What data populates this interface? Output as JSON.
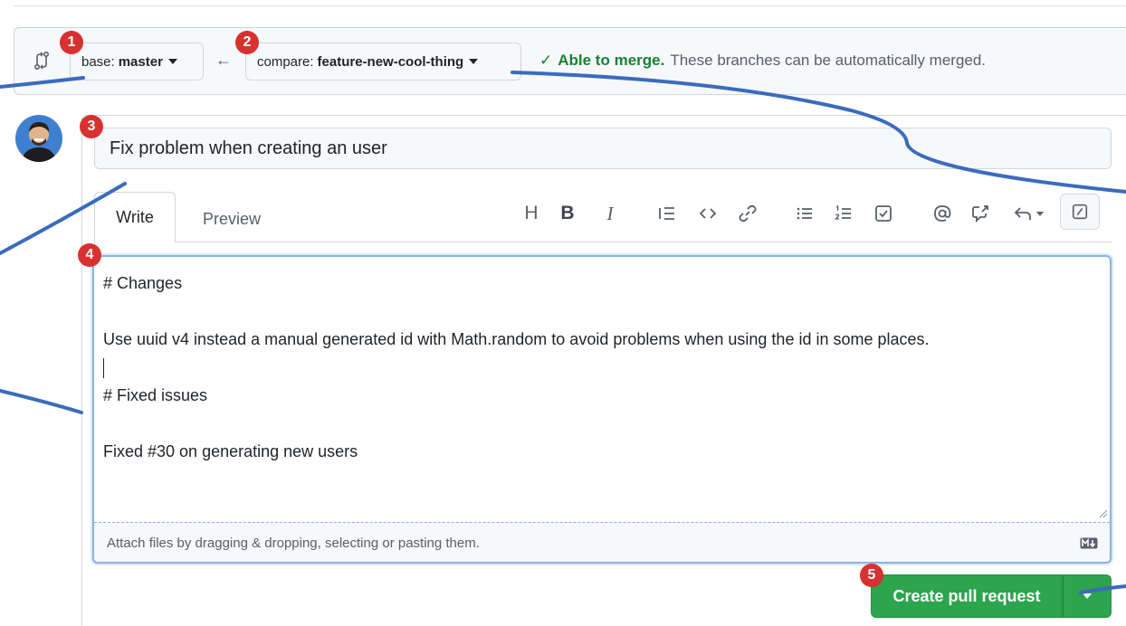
{
  "compare": {
    "base_label": "base:",
    "base_value": "master",
    "compare_label": "compare:",
    "compare_value": "feature-new-cool-thing",
    "arrow": "←",
    "status_check": "✓",
    "status_ok": "Able to merge.",
    "status_text": "These branches can be automatically merged."
  },
  "form": {
    "title_value": "Fix problem when creating an user",
    "tabs": [
      "Write",
      "Preview"
    ],
    "toolbar": [
      {
        "name": "heading",
        "glyph": "H"
      },
      {
        "name": "bold",
        "glyph": "B"
      },
      {
        "name": "italic",
        "glyph": "I"
      }
    ],
    "body_lines": [
      "# Changes",
      "",
      "Use uuid v4 instead a manual generated id with Math.random to avoid problems when using the id in some places.",
      "",
      "# Fixed issues",
      "",
      "Fixed #30 on generating new users"
    ],
    "attach_text": "Attach files by dragging & dropping, selecting or pasting them.",
    "submit_label": "Create pull request"
  },
  "annotations": [
    "1",
    "2",
    "3",
    "4",
    "5"
  ],
  "colors": {
    "accent_green": "#2da44e",
    "success_text": "#1a7f37",
    "badge_red": "#d93030",
    "annotation_line": "#3b6bbd",
    "focus_border": "#8cb2e6"
  }
}
